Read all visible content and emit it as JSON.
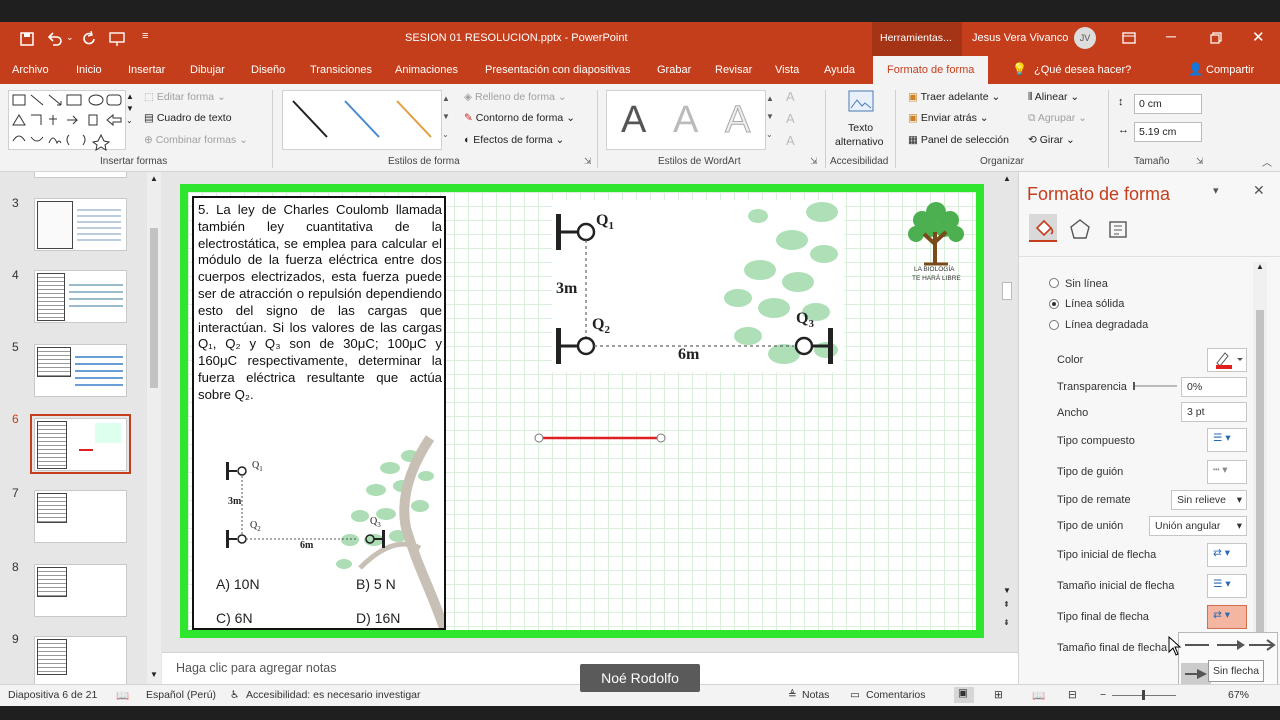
{
  "window": {
    "title": "SESION 01 RESOLUCION.pptx  -  PowerPoint",
    "tools_label": "Herramientas...",
    "user": "Jesus Vera Vivanco",
    "user_initials": "JV"
  },
  "tabs": [
    "Archivo",
    "Inicio",
    "Insertar",
    "Dibujar",
    "Diseño",
    "Transiciones",
    "Animaciones",
    "Presentación con diapositivas",
    "Grabar",
    "Revisar",
    "Vista",
    "Ayuda",
    "Formato de forma"
  ],
  "tell_me": "¿Qué desea hacer?",
  "share": "Compartir",
  "ribbon": {
    "edit_shape": "Editar forma",
    "text_box": "Cuadro de texto",
    "merge_shapes": "Combinar formas",
    "group_insert": "Insertar formas",
    "fill": "Relleno de forma",
    "outline": "Contorno de forma",
    "effects": "Efectos de forma",
    "group_styles": "Estilos de forma",
    "group_wordart": "Estilos de WordArt",
    "alt_text_1": "Texto",
    "alt_text_2": "alternativo",
    "group_accessibility": "Accesibilidad",
    "bring_forward": "Traer adelante",
    "send_backward": "Enviar atrás",
    "selection_pane": "Panel de selección",
    "align": "Alinear",
    "group": "Agrupar",
    "rotate": "Girar",
    "group_arrange": "Organizar",
    "height": "0 cm",
    "width": "5.19 cm",
    "group_size": "Tamaño"
  },
  "thumbnails": [
    {
      "num": "3"
    },
    {
      "num": "4"
    },
    {
      "num": "5"
    },
    {
      "num": "6"
    },
    {
      "num": "7"
    },
    {
      "num": "8"
    },
    {
      "num": "9"
    }
  ],
  "slide": {
    "question": "5. La ley de Charles Coulomb llamada también ley cuantitativa de la electrostática, se emplea para calcular el módulo de la fuerza eléctrica entre dos cuerpos electrizados, esta fuerza puede ser de atracción o repulsión dependiendo esto del signo de las cargas que interactúan. Si los valores de las cargas Q₁, Q₂ y Q₃ son de 30μC; 100μC y 160μC respectivamente, determinar la fuerza eléctrica resultante que actúa sobre Q₂.",
    "q1": "Q",
    "q1_sub": "1",
    "q2": "Q",
    "q2_sub": "2",
    "q3": "Q",
    "q3_sub": "3",
    "dist_v": "3m",
    "dist_h": "6m",
    "options": [
      "A) 10N",
      "B) 5 N",
      "C) 6N",
      "D) 16N"
    ],
    "logo_line1": "LA BIOLOGÍA",
    "logo_line2": "TE HARÁ LIBRE"
  },
  "notes_placeholder": "Haga clic para agregar notas",
  "panel": {
    "title": "Formato de forma",
    "line_options": [
      "Sin línea",
      "Línea sólida",
      "Línea degradada"
    ],
    "selected_line_option": "Línea sólida",
    "color_label": "Color",
    "transparency_label": "Transparencia",
    "transparency_value": "0%",
    "width_label": "Ancho",
    "width_value": "3 pt",
    "compound_label": "Tipo compuesto",
    "dash_label": "Tipo de guión",
    "cap_label": "Tipo de remate",
    "cap_value": "Sin relieve",
    "join_label": "Tipo de unión",
    "join_value": "Unión angular",
    "begin_arrow_label": "Tipo inicial de flecha",
    "begin_size_label": "Tamaño inicial de flecha",
    "end_arrow_label": "Tipo final de flecha",
    "end_size_label": "Tamaño final de flecha",
    "tooltip": "Sin flecha",
    "line_color": "#e02020"
  },
  "status": {
    "slide_info": "Diapositiva 6 de 21",
    "language": "Español (Perú)",
    "accessibility": "Accesibilidad: es necesario investigar",
    "notes": "Notas",
    "comments": "Comentarios",
    "zoom": "67%"
  },
  "caption": "Noé Rodolfo",
  "colors": {
    "accent": "#c43e1c",
    "slide_border": "#2ee62e",
    "selected_line": "#e02020"
  }
}
